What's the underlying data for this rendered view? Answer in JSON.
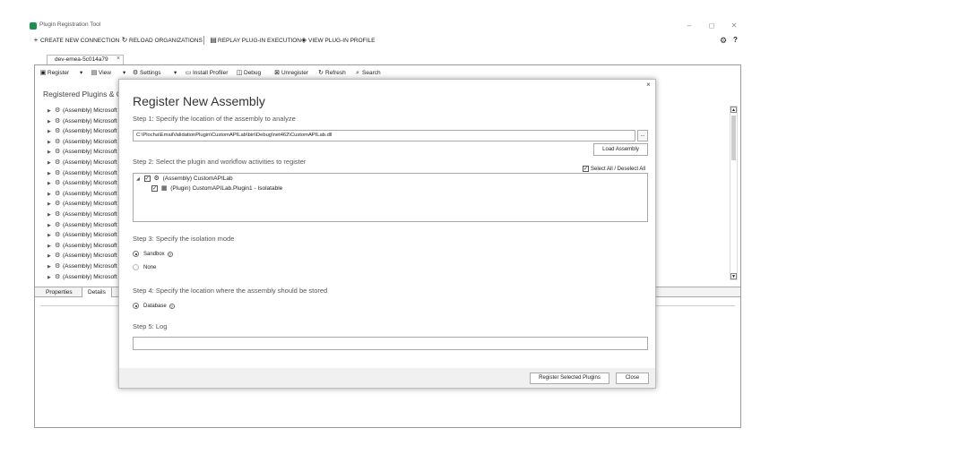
{
  "window": {
    "title": "Plugin Registration Tool",
    "minimize": "–",
    "restore": "◻",
    "close": "✕"
  },
  "topbar": {
    "create": "CREATE NEW CONNECTION",
    "reload": "RELOAD ORGANIZATIONS",
    "replay": "REPLAY PLUG-IN EXECUTION",
    "view_profile": "VIEW PLUG-IN PROFILE"
  },
  "connection_tab": {
    "label": "dev-emea-5c014a79",
    "close": "×"
  },
  "toolbar": {
    "register": "Register",
    "view": "View",
    "settings": "Settings",
    "install_profiler": "Install Profiler",
    "debug": "Debug",
    "unregister": "Unregister",
    "refresh": "Refresh",
    "search": "Search"
  },
  "panel": {
    "heading": "Registered Plugins & Cu",
    "items": [
      "(Assembly) Microsoft",
      "(Assembly) Microsoft",
      "(Assembly) Microsoft",
      "(Assembly) Microsoft",
      "(Assembly) Microsoft",
      "(Assembly) Microsoft",
      "(Assembly) Microsoft",
      "(Assembly) Microsoft",
      "(Assembly) Microsoft",
      "(Assembly) Microsoft",
      "(Assembly) Microsoft",
      "(Assembly) Microsoft",
      "(Assembly) Microsoft",
      "(Assembly) Microsoft",
      "(Assembly) Microsoft",
      "(Assembly) Microsoft",
      "(Assembly) Microsoft"
    ],
    "tab_properties": "Properties",
    "tab_details": "Details"
  },
  "dialog": {
    "title": "Register New Assembly",
    "close": "×",
    "step1": "Step 1: Specify the location of the assembly to analyze",
    "path": "C:\\Plocha\\EmailValidationPlugin\\CustomAPILab\\bin\\Debug\\net462\\CustomAPILab.dll",
    "browse": "...",
    "load_assembly": "Load Assembly",
    "step2": "Step 2: Select the plugin and workflow activities to register",
    "select_all": "Select All / Deselect All",
    "assembly_node": "(Assembly) CustomAPILab",
    "plugin_node": "(Plugin) CustomAPILab.Plugin1 - Isolatable",
    "step3": "Step 3: Specify the isolation mode",
    "sandbox": "Sandbox",
    "none": "None",
    "step4": "Step 4: Specify the location where the assembly should be stored",
    "database": "Database",
    "step5": "Step 5: Log",
    "log_value": "",
    "register_selected": "Register Selected Plugins",
    "close_button": "Close",
    "isolation_selected": "Sandbox",
    "storage_selected": "Database",
    "assembly_checked": true,
    "plugin_checked": true,
    "select_all_checked": true
  },
  "icons": {
    "app": "plugin-app-icon",
    "plus": "plus-icon",
    "reload": "reload-icon",
    "replay": "replay-icon",
    "view_profile": "view-profile-icon",
    "settings": "gear-icon",
    "help": "help-icon"
  },
  "colors": {
    "app_icon": "#1e8f4e",
    "dialog_footer": "#f0f0f0",
    "border": "#9a9a9a"
  }
}
